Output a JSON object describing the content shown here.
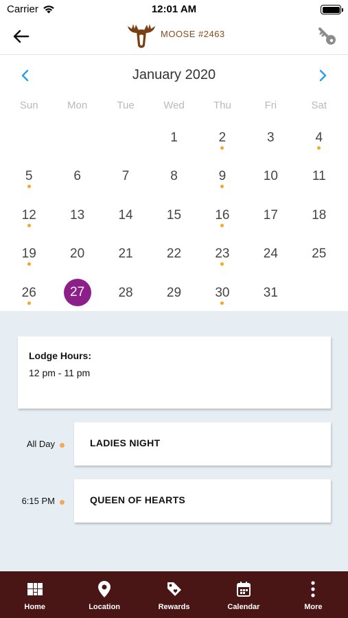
{
  "status_bar": {
    "carrier": "Carrier",
    "time": "12:01 AM"
  },
  "header": {
    "brand_name": "MOOSE #2463",
    "back_icon": "arrow-left-icon",
    "key_icon": "key-icon"
  },
  "calendar": {
    "month_title": "January 2020",
    "weekdays": [
      "Sun",
      "Mon",
      "Tue",
      "Wed",
      "Thu",
      "Fri",
      "Sat"
    ],
    "first_weekday_index": 3,
    "days_in_month": 31,
    "selected_day": 27,
    "days_with_events": [
      2,
      4,
      5,
      9,
      12,
      16,
      19,
      23,
      26,
      30
    ],
    "accent_color": "#8c1f8a",
    "event_dot_color": "#f4a72a",
    "nav_arrow_color": "#2a9df4"
  },
  "lodge_hours": {
    "title": "Lodge Hours:",
    "value": "12 pm - 11 pm"
  },
  "events": [
    {
      "time": "All Day",
      "title": "LADIES NIGHT"
    },
    {
      "time": "6:15 PM",
      "title": "QUEEN OF HEARTS"
    }
  ],
  "tabbar": {
    "color": "#4a1515",
    "items": [
      {
        "label": "Home",
        "icon": "grid-icon"
      },
      {
        "label": "Location",
        "icon": "location-pin-icon"
      },
      {
        "label": "Rewards",
        "icon": "tag-icon"
      },
      {
        "label": "Calendar",
        "icon": "calendar-icon"
      },
      {
        "label": "More",
        "icon": "more-vertical-icon"
      }
    ]
  }
}
